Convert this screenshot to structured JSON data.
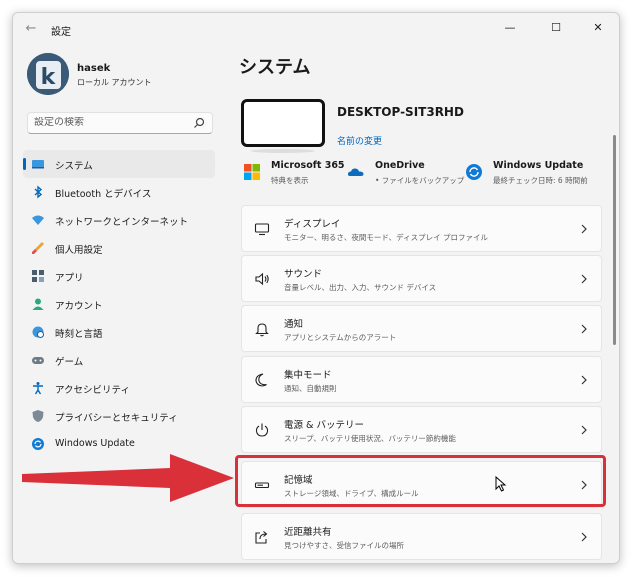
{
  "window": {
    "title": "設定"
  },
  "user": {
    "name": "hasek",
    "account_type": "ローカル アカウント",
    "avatar_letter": "k"
  },
  "search": {
    "placeholder": "設定の検索"
  },
  "sidebar": {
    "items": [
      {
        "label": "システム",
        "icon": "system-icon",
        "active": true
      },
      {
        "label": "Bluetooth とデバイス",
        "icon": "bluetooth-icon"
      },
      {
        "label": "ネットワークとインターネット",
        "icon": "wifi-icon"
      },
      {
        "label": "個人用設定",
        "icon": "brush-icon"
      },
      {
        "label": "アプリ",
        "icon": "apps-icon"
      },
      {
        "label": "アカウント",
        "icon": "account-icon"
      },
      {
        "label": "時刻と言語",
        "icon": "globe-clock-icon"
      },
      {
        "label": "ゲーム",
        "icon": "gamepad-icon"
      },
      {
        "label": "アクセシビリティ",
        "icon": "accessibility-icon"
      },
      {
        "label": "プライバシーとセキュリティ",
        "icon": "shield-icon"
      },
      {
        "label": "Windows Update",
        "icon": "update-icon"
      }
    ]
  },
  "main": {
    "title": "システム",
    "device": {
      "name": "DESKTOP-SIT3RHD",
      "rename_label": "名前の変更"
    },
    "quick": [
      {
        "title": "Microsoft 365",
        "sub": "特典を表示",
        "icon": "microsoft-icon"
      },
      {
        "title": "OneDrive",
        "sub": "• ファイルをバックアップ",
        "icon": "onedrive-icon"
      },
      {
        "title": "Windows Update",
        "sub": "最終チェック日時: 6 時間前",
        "icon": "update-icon"
      }
    ],
    "cards": [
      {
        "title": "ディスプレイ",
        "sub": "モニター、明るさ、夜間モード、ディスプレイ プロファイル",
        "icon": "display-icon"
      },
      {
        "title": "サウンド",
        "sub": "音量レベル、出力、入力、サウンド デバイス",
        "icon": "sound-icon"
      },
      {
        "title": "通知",
        "sub": "アプリとシステムからのアラート",
        "icon": "bell-icon"
      },
      {
        "title": "集中モード",
        "sub": "通知、自動規則",
        "icon": "moon-icon"
      },
      {
        "title": "電源 & バッテリー",
        "sub": "スリープ、バッテリ使用状況、バッテリー節約機能",
        "icon": "power-icon"
      },
      {
        "title": "記憶域",
        "sub": "ストレージ領域、ドライブ、構成ルール",
        "icon": "storage-icon"
      },
      {
        "title": "近距離共有",
        "sub": "見つけやすさ、受信ファイルの場所",
        "icon": "share-icon"
      }
    ]
  },
  "colors": {
    "accent": "#0067c0",
    "annotation": "#d9303a"
  }
}
